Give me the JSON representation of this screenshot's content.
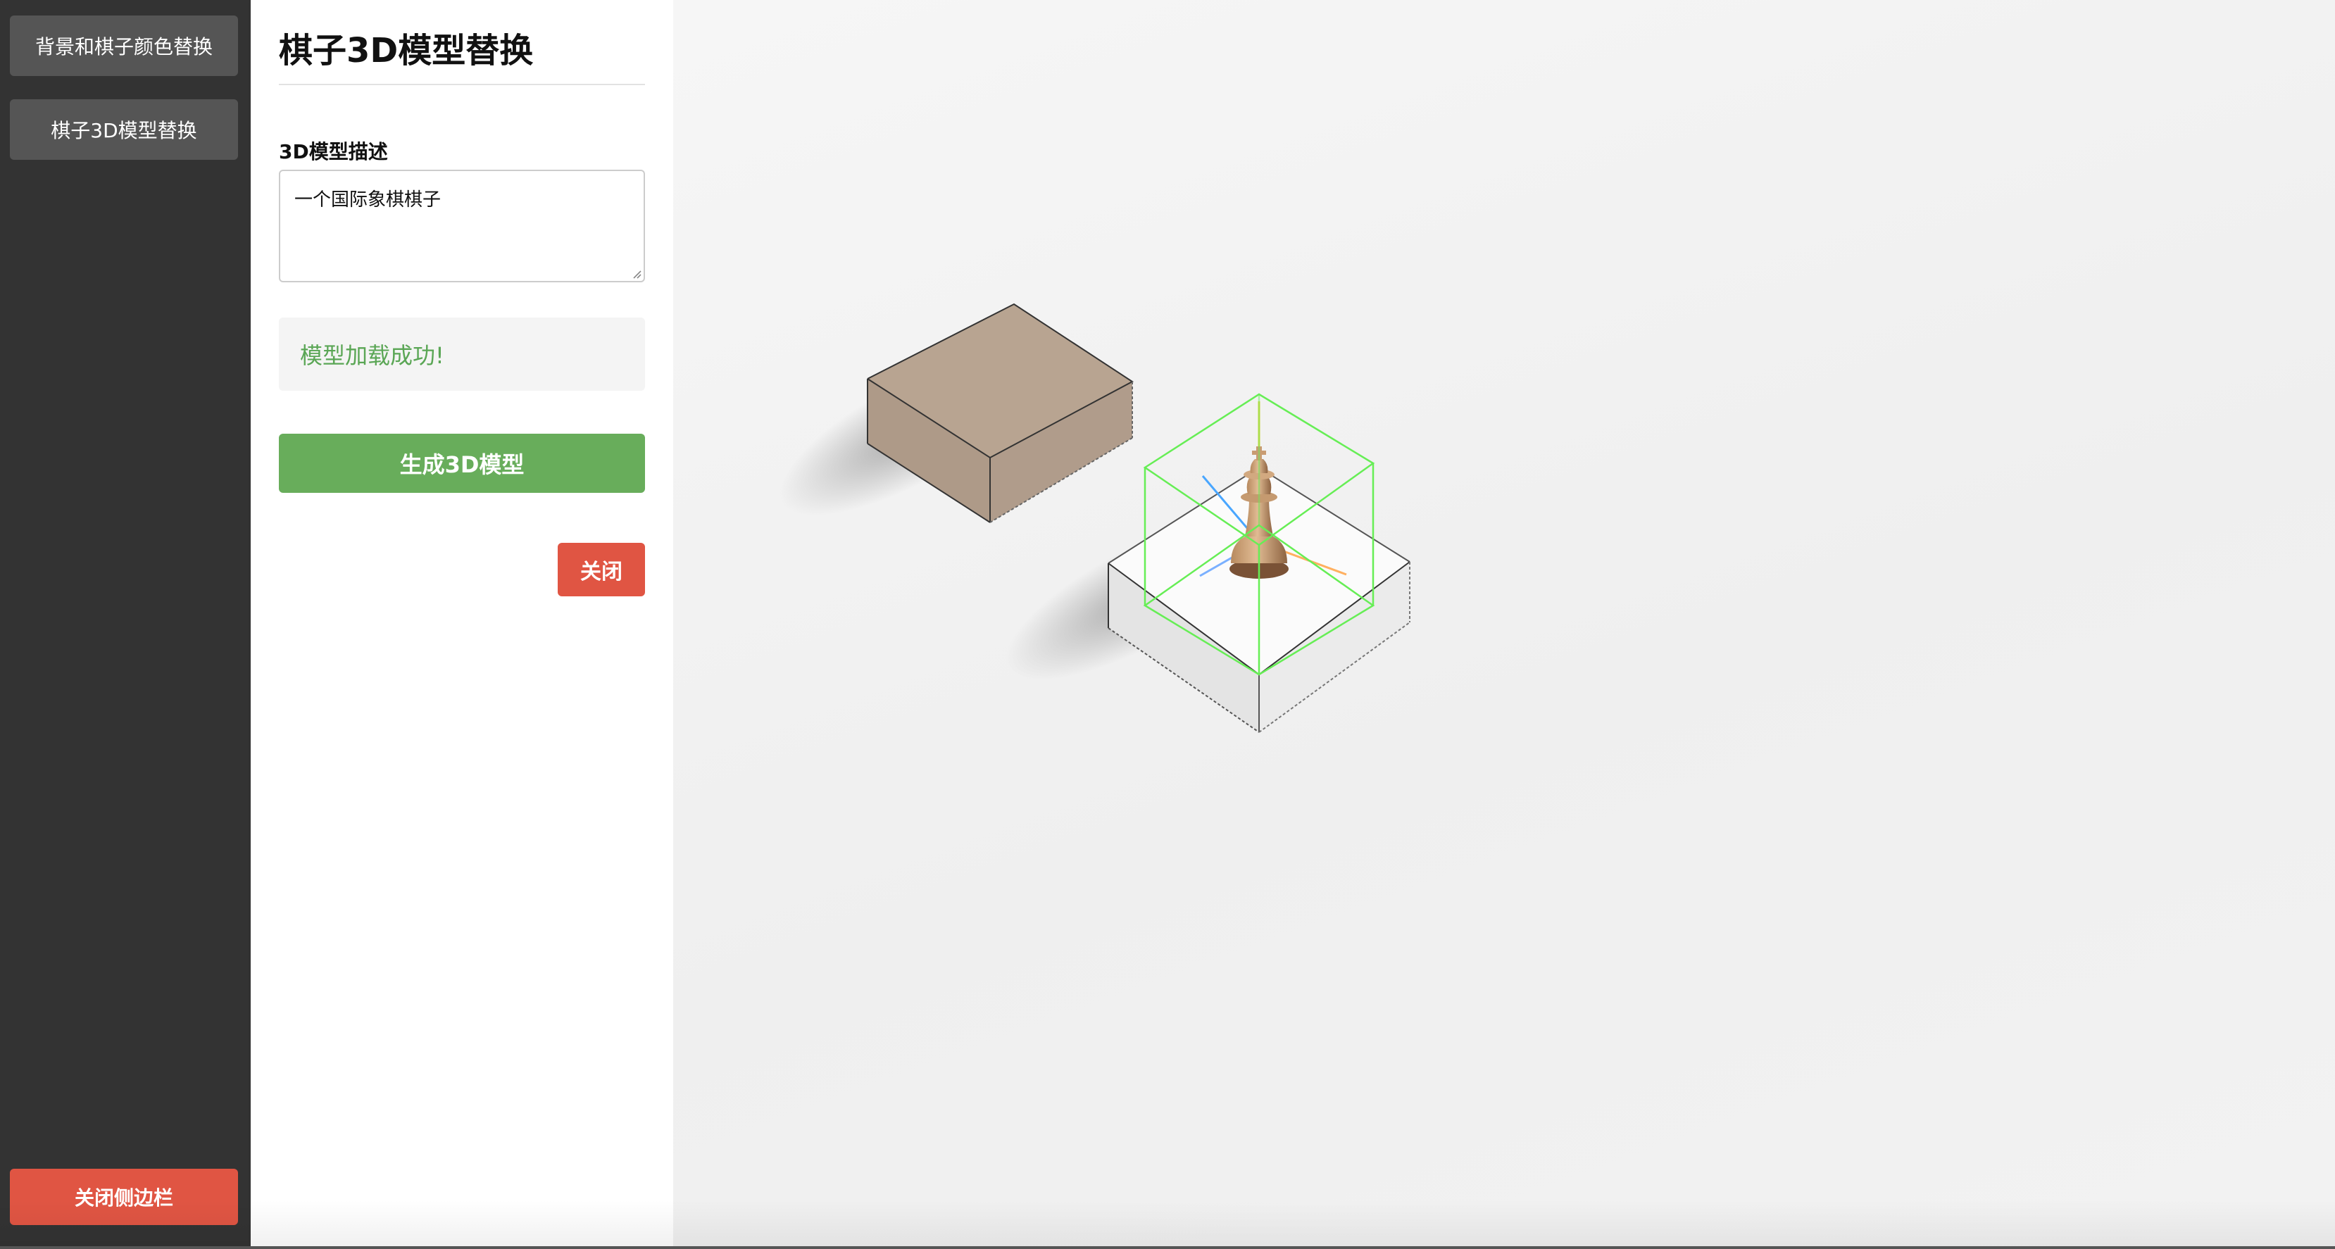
{
  "sidebar": {
    "items": [
      {
        "label": "背景和棋子颜色替换"
      },
      {
        "label": "棋子3D模型替换"
      }
    ],
    "close_label": "关闭侧边栏"
  },
  "panel": {
    "title": "棋子3D模型替换",
    "field_label": "3D模型描述",
    "description_value": "一个国际象棋棋子",
    "status_text": "模型加载成功!",
    "generate_label": "生成3D模型",
    "close_label": "关闭"
  },
  "colors": {
    "sidebar_bg": "#333333",
    "sidebar_button": "#555555",
    "danger": "#e05543",
    "success_text": "#5aa655",
    "primary_green": "#68ad5b",
    "selection_box": "#66ee55"
  },
  "scene": {
    "objects": [
      "brown-cube",
      "white-cube",
      "chess-king-piece",
      "selection-bounding-box",
      "axis-helper"
    ]
  }
}
